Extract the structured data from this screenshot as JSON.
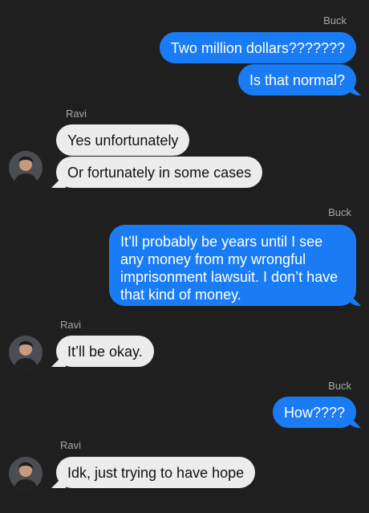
{
  "conversation": {
    "messages": [
      {
        "sender": "Buck",
        "direction": "outgoing",
        "text": "Two million dollars???????"
      },
      {
        "sender": "Buck",
        "direction": "outgoing",
        "text": "Is that normal?"
      },
      {
        "sender": "Ravi",
        "direction": "incoming",
        "text": "Yes unfortunately"
      },
      {
        "sender": "Ravi",
        "direction": "incoming",
        "text": "Or fortunately in some cases"
      },
      {
        "sender": "Buck",
        "direction": "outgoing",
        "text": "It’ll probably be years until I see any money from my wrongful imprisonment lawsuit. I don’t have that kind of money."
      },
      {
        "sender": "Ravi",
        "direction": "incoming",
        "text": "It’ll be okay."
      },
      {
        "sender": "Buck",
        "direction": "outgoing",
        "text": "How????"
      },
      {
        "sender": "Ravi",
        "direction": "incoming",
        "text": "Idk, just trying to have hope"
      }
    ]
  },
  "colors": {
    "background": "#1f1f1f",
    "outgoing_bubble": "#1a7cf5",
    "incoming_bubble": "#ececec",
    "sender_label": "#a7a7a7"
  },
  "icons": {
    "avatar": "contact-photo"
  }
}
